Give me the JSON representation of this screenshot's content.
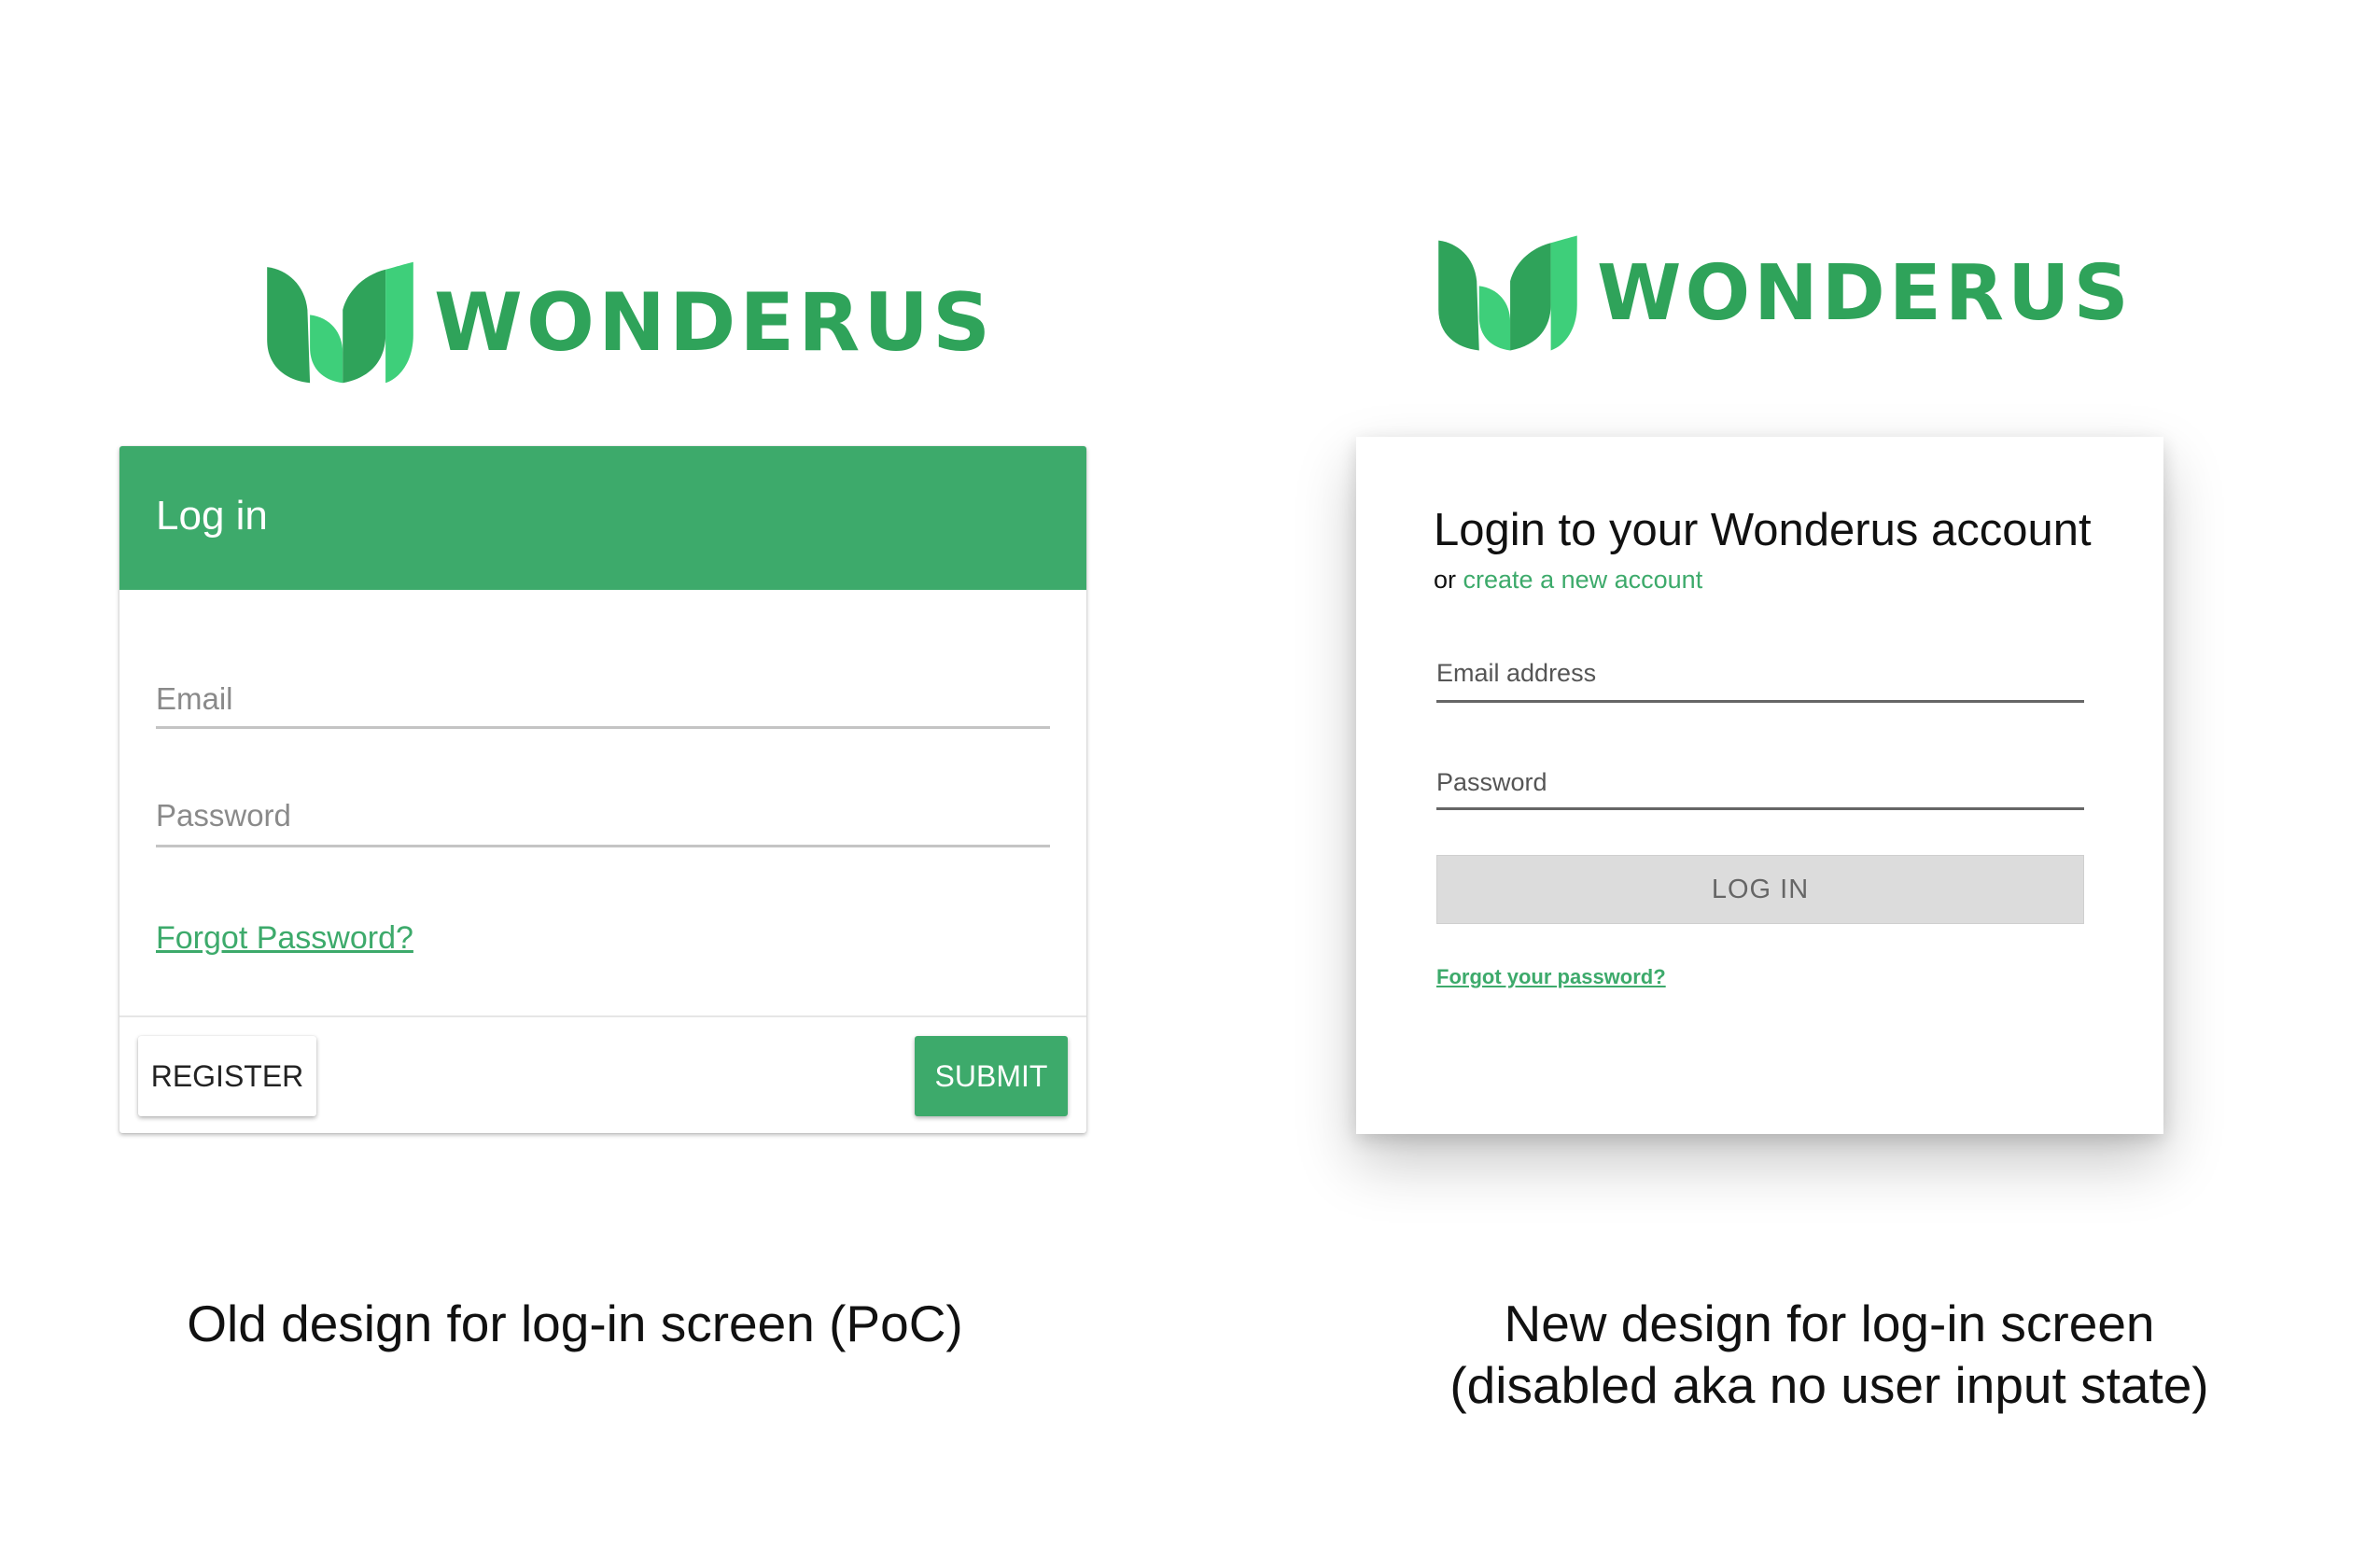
{
  "old_design": {
    "logo_text": "WONDERUS",
    "header_title": "Log in",
    "email_placeholder": "Email",
    "password_placeholder": "Password",
    "forgot_link": "Forgot Password?",
    "register_label": "REGISTER",
    "submit_label": "SUBMIT",
    "caption": "Old design for log-in screen (PoC)"
  },
  "new_design": {
    "logo_text": "WONDERUS",
    "title": "Login to your Wonderus account",
    "sub_prefix": "or",
    "create_account_link": "create a new account",
    "email_placeholder": "Email address",
    "password_placeholder": "Password",
    "login_label": "LOG IN",
    "forgot_link": "Forgot your password?",
    "caption_line1": "New design for log-in screen",
    "caption_line2": "(disabled aka no user input state)"
  },
  "colors": {
    "brand_green": "#3daa6b",
    "logo_green_dark": "#2fa35a",
    "logo_green_light": "#3ecf7a",
    "disabled_button": "#dcdcdc"
  },
  "icons": {
    "logo_mark": "leaf-w-logo-icon"
  }
}
